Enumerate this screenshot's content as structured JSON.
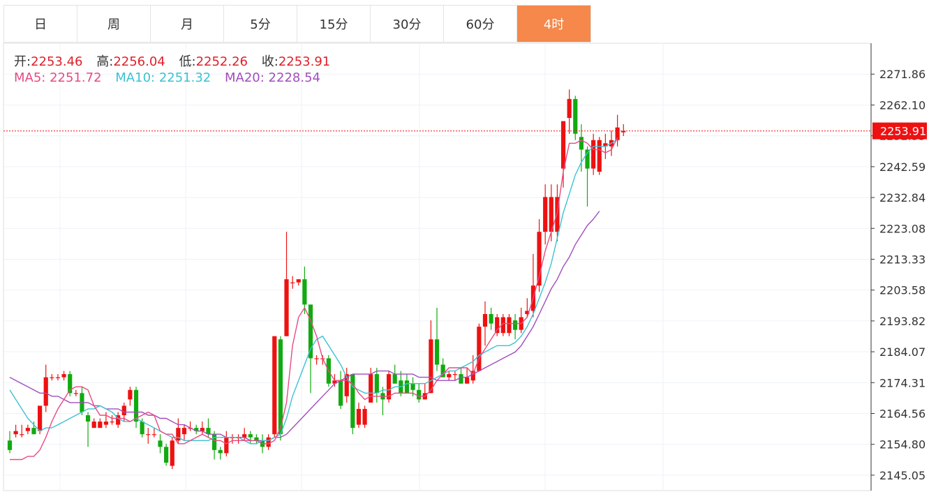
{
  "tabs": [
    {
      "label": "日"
    },
    {
      "label": "周"
    },
    {
      "label": "月"
    },
    {
      "label": "5分"
    },
    {
      "label": "15分"
    },
    {
      "label": "30分"
    },
    {
      "label": "60分"
    },
    {
      "label": "4时"
    }
  ],
  "active_tab": "4时",
  "ohlc": {
    "open_label": "开:",
    "open": "2253.46",
    "high_label": "高:",
    "high": "2256.04",
    "low_label": "低:",
    "low": "2252.26",
    "close_label": "收:",
    "close": "2253.91"
  },
  "ma": {
    "ma5_label": "MA5:",
    "ma5": "2251.72",
    "ma10_label": "MA10:",
    "ma10": "2251.32",
    "ma20_label": "MA20:",
    "ma20": "2228.54"
  },
  "colors": {
    "up": "#ee1111",
    "down": "#11aa11",
    "ma5": "#e84a83",
    "ma10": "#3cc2d1",
    "ma20": "#a14dbd",
    "accent": "#f5884a"
  },
  "chart_data": {
    "type": "candlestick",
    "ylim": [
      2140.17,
      2281.62
    ],
    "yticks": [
      "2271.86",
      "2262.10",
      "2252.35",
      "2242.59",
      "2232.84",
      "2223.08",
      "2213.33",
      "2203.58",
      "2193.82",
      "2184.07",
      "2174.31",
      "2164.56",
      "2154.80",
      "2145.05"
    ],
    "current_price": "2253.91",
    "candles": [
      [
        2156,
        2159,
        2152,
        2153
      ],
      [
        2158,
        2161,
        2157,
        2159
      ],
      [
        2158,
        2161,
        2157,
        2158
      ],
      [
        2159,
        2161,
        2158,
        2160
      ],
      [
        2160,
        2162,
        2158,
        2158
      ],
      [
        2159,
        2167,
        2158,
        2167
      ],
      [
        2167,
        2180,
        2165,
        2176
      ],
      [
        2176,
        2177,
        2175,
        2176
      ],
      [
        2176,
        2177,
        2175,
        2176
      ],
      [
        2176,
        2178,
        2175,
        2177
      ],
      [
        2177,
        2178,
        2170,
        2171
      ],
      [
        2171,
        2172,
        2170,
        2171
      ],
      [
        2171,
        2173,
        2164,
        2165
      ],
      [
        2164,
        2165,
        2154,
        2162
      ],
      [
        2160,
        2163,
        2160,
        2162
      ],
      [
        2160,
        2163,
        2160,
        2162
      ],
      [
        2161,
        2165,
        2160,
        2162
      ],
      [
        2162,
        2164,
        2161,
        2162
      ],
      [
        2161,
        2165,
        2160,
        2164
      ],
      [
        2164,
        2168,
        2162,
        2167
      ],
      [
        2169,
        2173,
        2167,
        2172
      ],
      [
        2172,
        2173,
        2160,
        2162
      ],
      [
        2162,
        2163,
        2157,
        2158
      ],
      [
        2158,
        2160,
        2155,
        2158
      ],
      [
        2158,
        2160,
        2157,
        2158
      ],
      [
        2156,
        2158,
        2152,
        2154
      ],
      [
        2154,
        2155,
        2148,
        2149
      ],
      [
        2148,
        2157,
        2147,
        2156
      ],
      [
        2156,
        2163,
        2155,
        2160
      ],
      [
        2158,
        2161,
        2156,
        2160
      ],
      [
        2160,
        2162,
        2159,
        2160
      ],
      [
        2160,
        2161,
        2158,
        2159
      ],
      [
        2159,
        2162,
        2158,
        2160
      ],
      [
        2160,
        2163,
        2157,
        2158
      ],
      [
        2158,
        2159,
        2150,
        2153
      ],
      [
        2153,
        2154,
        2150,
        2152
      ],
      [
        2152,
        2159,
        2151,
        2157
      ],
      [
        2157,
        2158,
        2155,
        2157
      ],
      [
        2157,
        2158,
        2155,
        2157
      ],
      [
        2157,
        2160,
        2156,
        2158
      ],
      [
        2158,
        2159,
        2155,
        2157
      ],
      [
        2157,
        2158,
        2155,
        2156
      ],
      [
        2156,
        2158,
        2152,
        2154
      ],
      [
        2154,
        2158,
        2153,
        2157
      ],
      [
        2158,
        2189,
        2157,
        2189
      ],
      [
        2188,
        2189,
        2156,
        2158
      ],
      [
        2189,
        2222,
        2189,
        2207
      ],
      [
        2206,
        2208,
        2204,
        2206
      ],
      [
        2206,
        2207,
        2205,
        2207
      ],
      [
        2207,
        2211,
        2196,
        2199
      ],
      [
        2199,
        2199,
        2171,
        2182
      ],
      [
        2182,
        2183,
        2180,
        2182
      ],
      [
        2182,
        2183,
        2180,
        2182
      ],
      [
        2182,
        2183,
        2173,
        2174
      ],
      [
        2174,
        2177,
        2173,
        2175
      ],
      [
        2175,
        2178,
        2166,
        2167
      ],
      [
        2170,
        2179,
        2168,
        2177
      ],
      [
        2177,
        2177,
        2158,
        2160
      ],
      [
        2161,
        2168,
        2160,
        2166
      ],
      [
        2161,
        2167,
        2160,
        2166
      ],
      [
        2168,
        2179,
        2168,
        2177
      ],
      [
        2177,
        2179,
        2168,
        2171
      ],
      [
        2171,
        2173,
        2164,
        2169
      ],
      [
        2169,
        2178,
        2168,
        2177
      ],
      [
        2177,
        2180,
        2174,
        2174
      ],
      [
        2175,
        2178,
        2170,
        2171
      ],
      [
        2175,
        2177,
        2171,
        2171
      ],
      [
        2174,
        2176,
        2170,
        2172
      ],
      [
        2172,
        2174,
        2168,
        2169
      ],
      [
        2169,
        2174,
        2169,
        2171
      ],
      [
        2171,
        2194,
        2171,
        2188
      ],
      [
        2188,
        2198,
        2178,
        2180
      ],
      [
        2180,
        2182,
        2176,
        2176
      ],
      [
        2176,
        2178,
        2175,
        2177
      ],
      [
        2177,
        2178,
        2175,
        2177
      ],
      [
        2177,
        2179,
        2174,
        2174
      ],
      [
        2174,
        2179,
        2174,
        2176
      ],
      [
        2175,
        2183,
        2174,
        2178
      ],
      [
        2178,
        2193,
        2178,
        2192
      ],
      [
        2192,
        2200,
        2186,
        2196
      ],
      [
        2196,
        2198,
        2191,
        2193
      ],
      [
        2190,
        2196,
        2189,
        2195
      ],
      [
        2190,
        2196,
        2189,
        2195
      ],
      [
        2190,
        2196,
        2189,
        2195
      ],
      [
        2194,
        2196,
        2188,
        2191
      ],
      [
        2191,
        2198,
        2190,
        2195
      ],
      [
        2196,
        2201,
        2195,
        2197
      ],
      [
        2197,
        2215,
        2195,
        2205
      ],
      [
        2205,
        2226,
        2203,
        2222
      ],
      [
        2222,
        2237,
        2218,
        2233
      ],
      [
        2222,
        2237,
        2219,
        2233
      ],
      [
        2222,
        2237,
        2219,
        2233
      ],
      [
        2242,
        2257,
        2236,
        2257
      ],
      [
        2258,
        2267,
        2253,
        2264
      ],
      [
        2264,
        2265,
        2251,
        2253
      ],
      [
        2252,
        2256,
        2241,
        2248
      ],
      [
        2248,
        2249,
        2230,
        2242
      ],
      [
        2242,
        2253,
        2240,
        2251
      ],
      [
        2241,
        2252,
        2240,
        2251
      ],
      [
        2249,
        2253,
        2245,
        2250
      ],
      [
        2249,
        2254,
        2246,
        2251
      ],
      [
        2251,
        2259,
        2249,
        2255
      ],
      [
        2253.46,
        2256.04,
        2252.26,
        2253.91
      ]
    ],
    "ma5": [
      2150,
      2150,
      2150,
      2151,
      2151,
      2153,
      2157,
      2162,
      2166,
      2169,
      2172,
      2173,
      2173,
      2172,
      2167,
      2164,
      2164,
      2163,
      2163,
      2163,
      2162,
      2163,
      2164,
      2165,
      2164,
      2159,
      2158,
      2158,
      2155,
      2155,
      2156,
      2157,
      2158,
      2157,
      2156,
      2156,
      2155,
      2156,
      2156,
      2156,
      2156,
      2156,
      2155,
      2155,
      2156,
      2160,
      2168,
      2186,
      2195,
      2198,
      2194,
      2189,
      2182,
      2178,
      2175,
      2175,
      2175,
      2174,
      2171,
      2169,
      2170,
      2170,
      2170,
      2170,
      2171,
      2171,
      2171,
      2171,
      2170,
      2170,
      2172,
      2175,
      2177,
      2179,
      2179,
      2179,
      2179,
      2177,
      2182,
      2185,
      2188,
      2191,
      2193,
      2193,
      2193,
      2193,
      2195,
      2201,
      2208,
      2216,
      2222,
      2228,
      2241,
      2250,
      2250,
      2251,
      2250,
      2248,
      2248,
      2247,
      2248,
      2251.72
    ],
    "ma10": [
      2172,
      2169,
      2166,
      2163,
      2161,
      2159,
      2160,
      2160,
      2161,
      2162,
      2163,
      2164,
      2165,
      2166,
      2166,
      2167,
      2166,
      2165,
      2163,
      2162,
      2162,
      2163,
      2162,
      2161,
      2160,
      2159,
      2158,
      2157,
      2157,
      2156,
      2156,
      2156,
      2156,
      2156,
      2157,
      2157,
      2157,
      2157,
      2157,
      2156,
      2155,
      2155,
      2156,
      2156,
      2157,
      2158,
      2163,
      2170,
      2175,
      2180,
      2185,
      2188,
      2189,
      2186,
      2183,
      2180,
      2176,
      2173,
      2172,
      2171,
      2171,
      2171,
      2172,
      2172,
      2173,
      2173,
      2174,
      2174,
      2174,
      2174,
      2175,
      2176,
      2177,
      2178,
      2178,
      2179,
      2180,
      2181,
      2183,
      2184,
      2185,
      2186,
      2186,
      2186,
      2187,
      2189,
      2192,
      2196,
      2201,
      2206,
      2212,
      2220,
      2228,
      2234,
      2240,
      2244,
      2247,
      2249,
      2249,
      2249,
      2250,
      2251.32
    ],
    "ma20": [
      2176,
      2175,
      2174,
      2173,
      2172,
      2171,
      2171,
      2170,
      2170,
      2169,
      2168,
      2168,
      2168,
      2168,
      2167,
      2167,
      2166,
      2166,
      2166,
      2165,
      2165,
      2165,
      2165,
      2164,
      2164,
      2163,
      2163,
      2162,
      2161,
      2161,
      2160,
      2159,
      2159,
      2158,
      2158,
      2158,
      2157,
      2157,
      2157,
      2157,
      2156,
      2156,
      2156,
      2156,
      2157,
      2157,
      2158,
      2160,
      2162,
      2164,
      2166,
      2168,
      2170,
      2172,
      2174,
      2175,
      2176,
      2177,
      2177,
      2177,
      2177,
      2178,
      2178,
      2178,
      2177,
      2177,
      2177,
      2177,
      2176,
      2176,
      2176,
      2175,
      2175,
      2175,
      2175,
      2176,
      2176,
      2177,
      2178,
      2179,
      2180,
      2181,
      2182,
      2183,
      2184,
      2186,
      2189,
      2192,
      2196,
      2200,
      2204,
      2207,
      2211,
      2214,
      2218,
      2221,
      2224,
      2226,
      2228.54
    ]
  }
}
